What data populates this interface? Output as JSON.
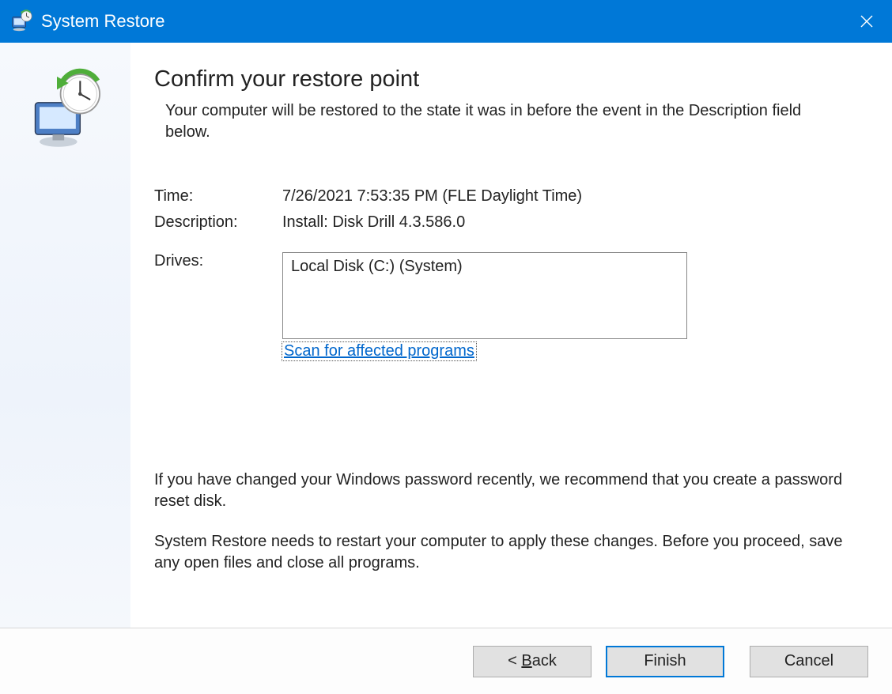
{
  "titlebar": {
    "title": "System Restore"
  },
  "content": {
    "heading": "Confirm your restore point",
    "subheading": "Your computer will be restored to the state it was in before the event in the Description field below.",
    "time_label": "Time:",
    "time_value": "7/26/2021 7:53:35 PM (FLE Daylight Time)",
    "description_label": "Description:",
    "description_value": "Install: Disk Drill 4.3.586.0",
    "drives_label": "Drives:",
    "drives_value": "Local Disk (C:) (System)",
    "scan_link": "Scan for affected programs",
    "password_note": "If you have changed your Windows password recently, we recommend that you create a password reset disk.",
    "restart_note": "System Restore needs to restart your computer to apply these changes. Before you proceed, save any open files and close all programs."
  },
  "buttons": {
    "back": "< Back",
    "finish": "Finish",
    "cancel": "Cancel"
  }
}
